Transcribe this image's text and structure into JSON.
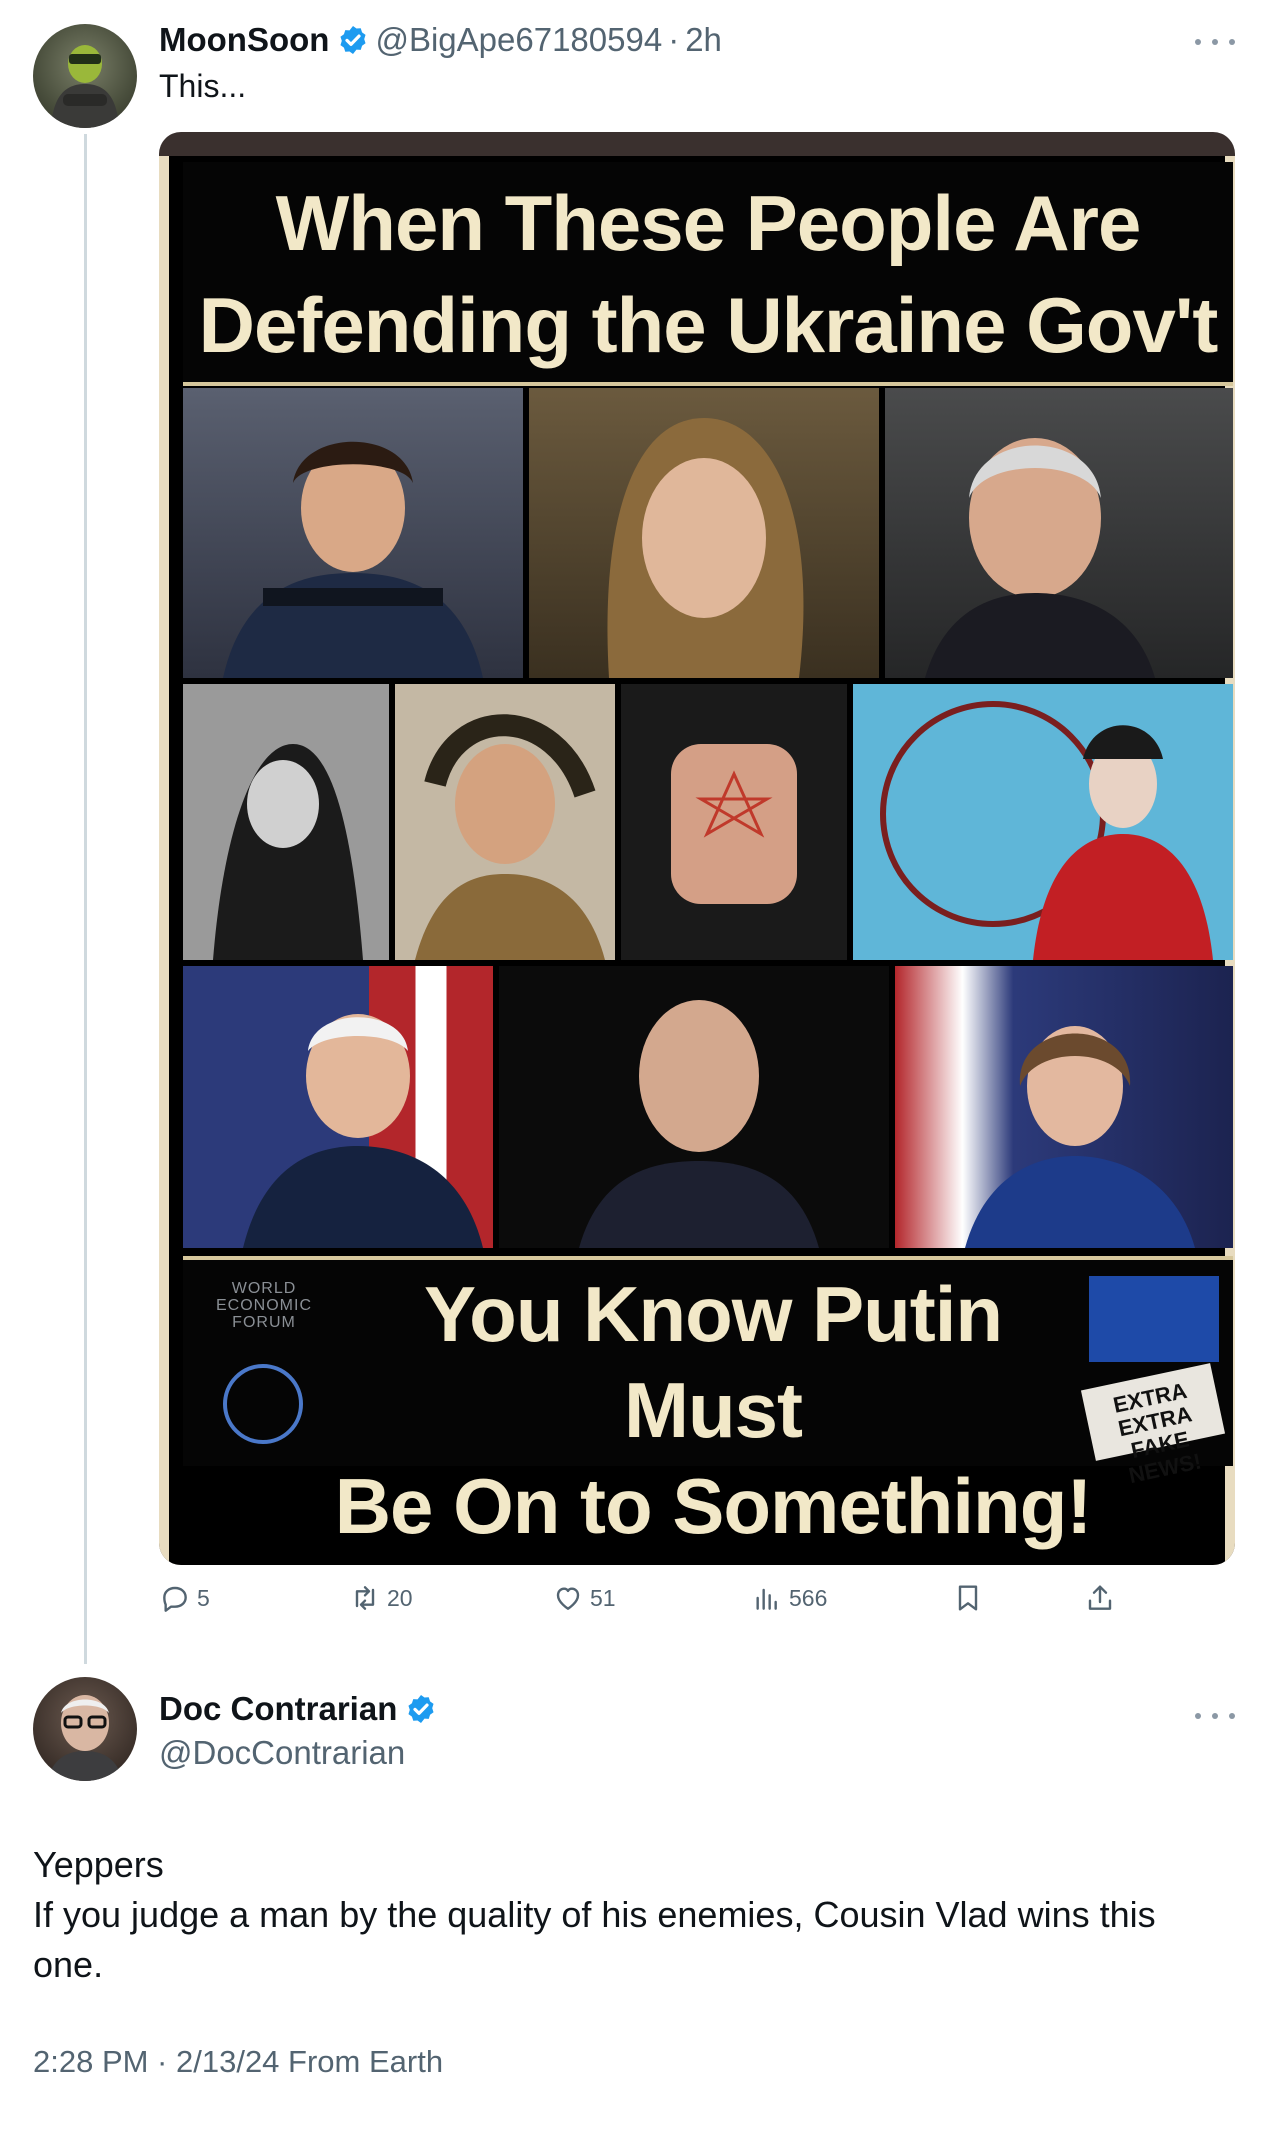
{
  "tweet1": {
    "display_name": "MoonSoon",
    "handle": "@BigApe67180594",
    "separator": "·",
    "time": "2h",
    "text": "This...",
    "image": {
      "title_line1": "When These People Are",
      "title_line2": "Defending the Ukraine Gov't",
      "bottom_line1": "You Know Putin Must",
      "bottom_line2": "Be On to Something!",
      "wef_line1": "WORLD",
      "wef_line2": "ECONOMIC",
      "wef_line3": "FORUM",
      "fake_news": "EXTRA EXTRA FAKE NEWS!"
    },
    "actions": {
      "replies": "5",
      "retweets": "20",
      "likes": "51",
      "views": "566"
    }
  },
  "tweet2": {
    "display_name": "Doc Contrarian",
    "handle": "@DocContrarian",
    "text_line1": "Yeppers",
    "text_line2": "If you judge a man by the quality of his enemies, Cousin Vlad wins this",
    "text_line3": "one.",
    "timestamp": "2:28 PM · 2/13/24 From Earth"
  },
  "colors": {
    "verified_badge": "#1d9bf0",
    "secondary_text": "#536471",
    "thread_line": "#cfd9de"
  },
  "icons": [
    "verified-badge-icon",
    "more-icon",
    "reply-icon",
    "retweet-icon",
    "like-icon",
    "views-icon",
    "bookmark-icon",
    "share-icon"
  ]
}
